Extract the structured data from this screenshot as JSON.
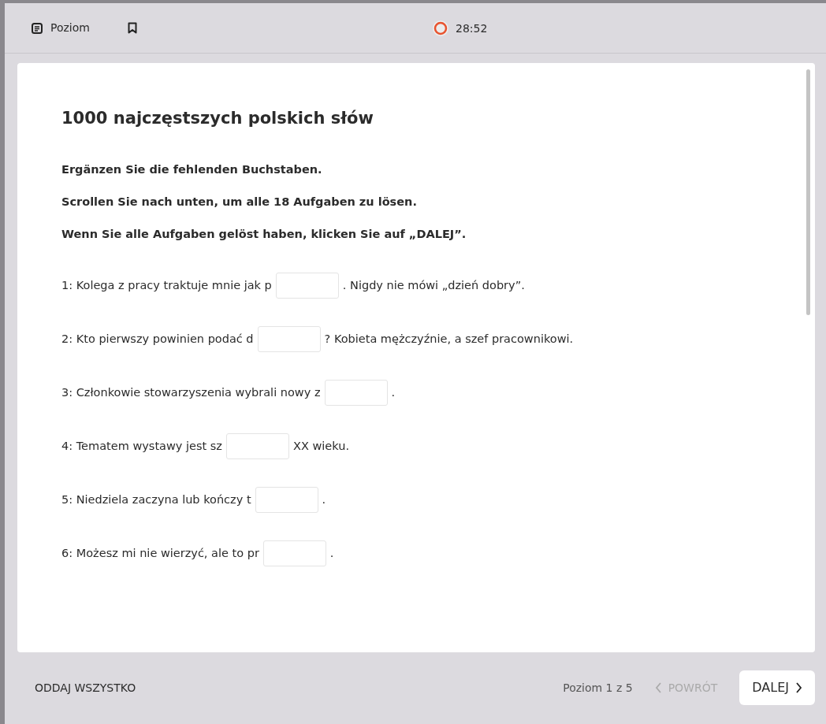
{
  "toolbar": {
    "level_label": "Poziom",
    "timer": "28:52"
  },
  "title": "1000 najczęstszych polskich słów",
  "instructions": [
    "Ergänzen Sie die fehlenden Buchstaben.",
    "Scrollen Sie nach unten, um alle 18 Aufgaben zu lösen.",
    "Wenn Sie alle Aufgaben gelöst haben, klicken Sie auf „DALEJ”."
  ],
  "tasks": [
    {
      "before": "1: Kolega z pracy traktuje mnie jak p",
      "after": ". Nigdy nie mówi „dzień dobry”."
    },
    {
      "before": "2: Kto pierwszy powinien podać d",
      "after": "? Kobieta mężczyźnie, a szef pracownikowi."
    },
    {
      "before": "3: Członkowie stowarzyszenia wybrali nowy z",
      "after": "."
    },
    {
      "before": "4: Tematem wystawy jest sz",
      "after": "XX wieku."
    },
    {
      "before": "5: Niedziela zaczyna lub kończy t",
      "after": "."
    },
    {
      "before": "6: Możesz mi nie wierzyć, ale to pr",
      "after": "."
    }
  ],
  "footer": {
    "submit_all": "ODDAJ WSZYSTKO",
    "progress": "Poziom 1 z 5",
    "back": {
      "label": "POWRÓT",
      "disabled": true
    },
    "next": {
      "label": "DALEJ",
      "disabled": false
    }
  }
}
